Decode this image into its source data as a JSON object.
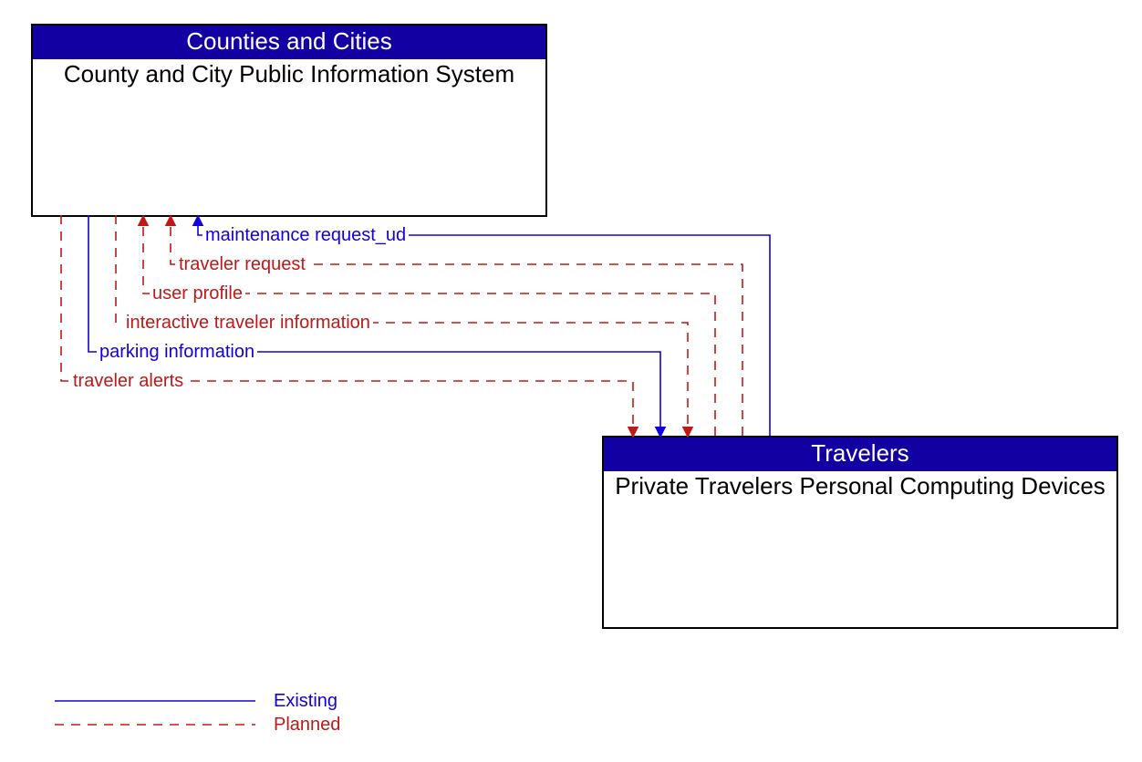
{
  "boxes": {
    "top": {
      "header": "Counties and Cities",
      "body": "County and City Public Information System"
    },
    "bottom": {
      "header": "Travelers",
      "body": "Private Travelers Personal Computing Devices"
    }
  },
  "flows": [
    {
      "id": "maintenance_request_ud",
      "label": "maintenance request_ud",
      "style": "existing",
      "direction": "to_top"
    },
    {
      "id": "traveler_request",
      "label": "traveler request",
      "style": "planned",
      "direction": "to_top"
    },
    {
      "id": "user_profile",
      "label": "user profile",
      "style": "planned",
      "direction": "to_top"
    },
    {
      "id": "interactive_traveler_information",
      "label": "interactive traveler information",
      "style": "planned",
      "direction": "to_bottom"
    },
    {
      "id": "parking_information",
      "label": "parking information",
      "style": "existing",
      "direction": "to_bottom"
    },
    {
      "id": "traveler_alerts",
      "label": "traveler alerts",
      "style": "planned",
      "direction": "to_bottom"
    }
  ],
  "legend": {
    "existing": "Existing",
    "planned": "Planned"
  },
  "colors": {
    "header_bg": "#1200A3",
    "existing_line": "#1200E0",
    "planned_line": "#C01818"
  }
}
